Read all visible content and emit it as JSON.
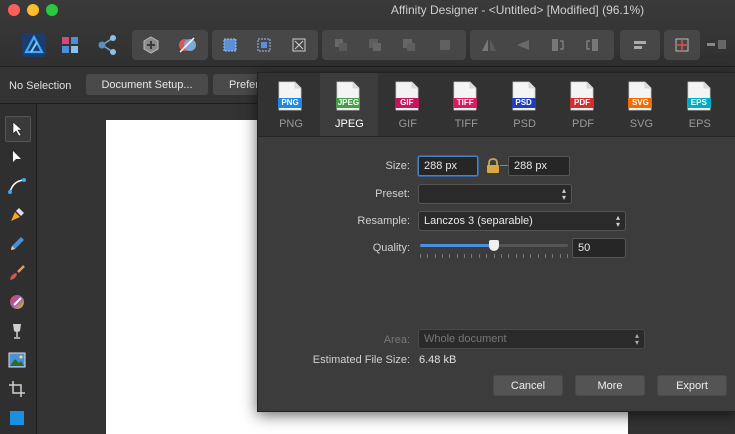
{
  "window": {
    "title": "Affinity Designer - <Untitled> [Modified] (96.1%)",
    "traffic_colors": [
      "#fe5f57",
      "#febc2e",
      "#28c840"
    ]
  },
  "context_bar": {
    "selection_label": "No Selection",
    "document_setup_label": "Document Setup...",
    "preferences_label": "Prefer"
  },
  "toolbar_icons": [
    "designer-persona-icon",
    "pixel-persona-icon",
    "export-persona-icon",
    "boolean-add-icon",
    "boolean-subtract-icon",
    "align-icons",
    "flip-icons",
    "insert-icons",
    "snapping-icon"
  ],
  "tools": [
    "move-tool-icon",
    "node-tool-icon",
    "corner-tool-icon",
    "pen-tool-icon",
    "pencil-tool-icon",
    "brush-tool-icon",
    "fill-tool-icon",
    "transparency-tool-icon",
    "place-image-icon",
    "crop-tool-icon",
    "rectangle-tool-icon"
  ],
  "export": {
    "formats": [
      {
        "label": "PNG",
        "badge": "PNG",
        "color": "#1e88e5",
        "selected": false
      },
      {
        "label": "JPEG",
        "badge": "JPEG",
        "color": "#43a047",
        "selected": true
      },
      {
        "label": "GIF",
        "badge": "GIF",
        "color": "#c2185b",
        "selected": false
      },
      {
        "label": "TIFF",
        "badge": "TIFF",
        "color": "#d81b60",
        "selected": false
      },
      {
        "label": "PSD",
        "badge": "PSD",
        "color": "#1e3fb8",
        "selected": false
      },
      {
        "label": "PDF",
        "badge": "PDF",
        "color": "#d32f2f",
        "selected": false
      },
      {
        "label": "SVG",
        "badge": "SVG",
        "color": "#ef6c00",
        "selected": false
      },
      {
        "label": "EPS",
        "badge": "EPS",
        "color": "#00acc1",
        "selected": false
      }
    ],
    "size_label": "Size:",
    "width_value": "288 px",
    "height_value": "288 px",
    "preset_label": "Preset:",
    "preset_value": "",
    "resample_label": "Resample:",
    "resample_value": "Lanczos 3 (separable)",
    "quality_label": "Quality:",
    "quality_value": "50",
    "quality_fraction": 0.5,
    "area_label": "Area:",
    "area_value": "Whole document",
    "file_size_label": "Estimated File Size:",
    "file_size_value": "6.48 kB",
    "cancel_label": "Cancel",
    "more_label": "More",
    "export_label": "Export"
  }
}
